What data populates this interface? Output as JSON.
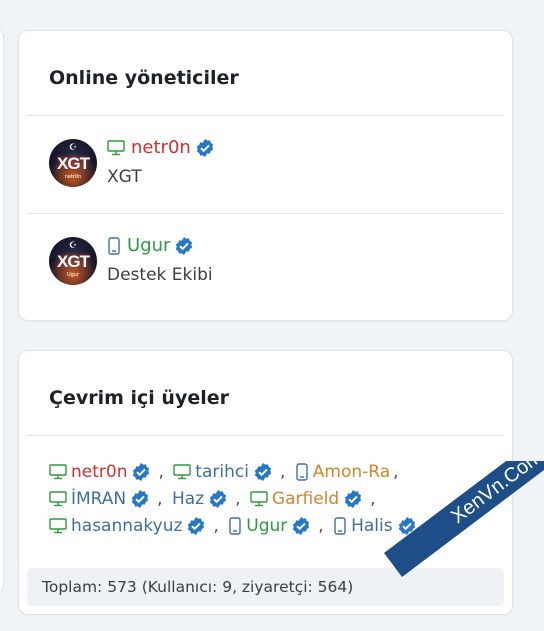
{
  "admins": {
    "title": "Online yöneticiler",
    "users": [
      {
        "name": "netr0n",
        "name_color": "#d32f2f",
        "device": "desktop",
        "subtitle": "XGT",
        "avatar_text": "XGT",
        "avatar_sub": "netr0n"
      },
      {
        "name": "Ugur",
        "name_color": "#2e9a3e",
        "device": "mobile",
        "subtitle": "Destek Ekibi",
        "avatar_text": "XGT",
        "avatar_sub": "Ugur"
      }
    ]
  },
  "members": {
    "title": "Çevrim içi üyeler",
    "list": [
      {
        "name": "netr0n",
        "color": "#d32f2f",
        "device": "desktop",
        "verified": true
      },
      {
        "name": "tarihci",
        "color": "#3f6fa1",
        "device": "desktop",
        "verified": true
      },
      {
        "name": "Amon-Ra",
        "color": "#d2862a",
        "device": "mobile",
        "verified": false
      },
      {
        "name": "İMRAN",
        "color": "#3f6fa1",
        "device": "desktop",
        "verified": true
      },
      {
        "name": "Haz",
        "color": "#3f6fa1",
        "device": "none",
        "verified": true
      },
      {
        "name": "Garfield",
        "color": "#d2862a",
        "device": "desktop",
        "verified": true
      },
      {
        "name": "hasannakyuz",
        "color": "#3f6fa1",
        "device": "desktop",
        "verified": true
      },
      {
        "name": "Ugur",
        "color": "#2e9a3e",
        "device": "mobile",
        "verified": true
      },
      {
        "name": "Halis",
        "color": "#3f6fa1",
        "device": "mobile",
        "verified": true
      }
    ],
    "footer": "Toplam: 573 (Kullanıcı: 9, ziyaretçi: 564)"
  },
  "watermark": "XenVn.Com",
  "colors": {
    "verified": "#2577c8",
    "device_icon": "#2e9a3e",
    "card_border": "#dfe3e8"
  }
}
